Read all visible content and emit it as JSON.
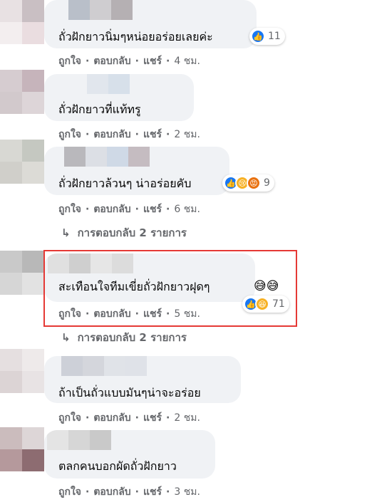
{
  "actions": {
    "like": "ถูกใจ",
    "reply": "ตอบกลับ",
    "share": "แชร์",
    "sep": "·"
  },
  "comments": [
    {
      "text": "ถั่วฝักยาวนิ่มๆหน่อยอร่อยเลยค่ะ",
      "time": "4 ชม.",
      "reaction_count": "11"
    },
    {
      "text": "ถั่วฝักยาวที่แท้ทรู",
      "time": "2 ชม."
    },
    {
      "text": "ถั่วฝักยาวล้วนๆ น่าอร่อยคับ",
      "time": "6 ชม.",
      "reaction_count": "9",
      "replies": "การตอบกลับ 2 รายการ"
    },
    {
      "text": "สะเทือนใจทีมเขี่ยถั่วฝักยาวฝุดๆ",
      "emojis": "😅😅",
      "time": "5 ชม.",
      "reaction_count": "71",
      "replies": "การตอบกลับ 2 รายการ"
    },
    {
      "text": "ถ้าเป็นถั่วแบบมันๆน่าจะอร่อย",
      "time": "2 ชม."
    },
    {
      "text": "ตลกคนบอกผัดถั่วฝักยาว",
      "time": "3 ชม."
    }
  ]
}
